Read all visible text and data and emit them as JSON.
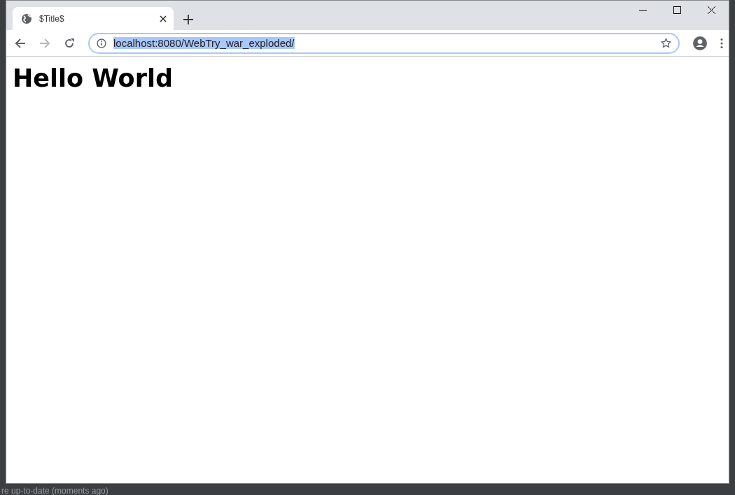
{
  "tab": {
    "title": "$Title$",
    "selected": true
  },
  "navigation": {
    "forward_disabled": true
  },
  "address_bar": {
    "url": "localhost:8080/WebTry_war_exploded/",
    "selected": true
  },
  "page": {
    "heading": "Hello World"
  },
  "ide_status_bar": {
    "text": "re up-to-date (moments ago)"
  }
}
